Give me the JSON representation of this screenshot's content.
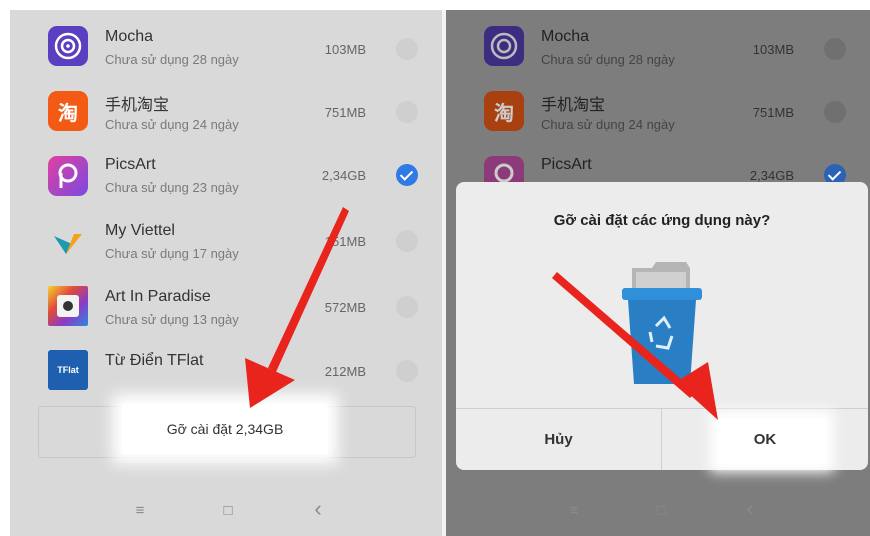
{
  "left_screen": {
    "apps": [
      {
        "name": "Mocha",
        "subtitle": "Chưa sử dụng 28 ngày",
        "size": "103MB",
        "checked": false,
        "icon": "mocha-icon"
      },
      {
        "name": "手机淘宝",
        "subtitle": "Chưa sử dụng 24 ngày",
        "size": "751MB",
        "checked": false,
        "icon": "taobao-icon"
      },
      {
        "name": "PicsArt",
        "subtitle": "Chưa sử dụng 23 ngày",
        "size": "2,34GB",
        "checked": true,
        "icon": "picsart-icon"
      },
      {
        "name": "My Viettel",
        "subtitle": "Chưa sử dụng 17 ngày",
        "size": "151MB",
        "checked": false,
        "icon": "myviettel-icon"
      },
      {
        "name": "Art In Paradise",
        "subtitle": "Chưa sử dụng 13 ngày",
        "size": "572MB",
        "checked": false,
        "icon": "art-in-paradise-icon"
      },
      {
        "name": "Từ Điển TFlat",
        "subtitle": "",
        "size": "212MB",
        "checked": false,
        "icon": "tflat-icon"
      }
    ],
    "uninstall_button": "Gỡ cài đặt 2,34GB",
    "nav": {
      "menu": "≡",
      "home": "□",
      "back": "‹"
    }
  },
  "right_screen": {
    "apps": [
      {
        "name": "Mocha",
        "subtitle": "Chưa sử dụng 28 ngày",
        "size": "103MB",
        "checked": false
      },
      {
        "name": "手机淘宝",
        "subtitle": "Chưa sử dụng 24 ngày",
        "size": "751MB",
        "checked": false
      },
      {
        "name": "PicsArt",
        "subtitle": "",
        "size": "2,34GB",
        "checked": true
      }
    ],
    "dialog": {
      "title": "Gỡ cài đặt các ứng dụng này?",
      "cancel": "Hủy",
      "ok": "OK"
    },
    "nav": {
      "menu": "≡",
      "home": "□",
      "back": "‹"
    }
  },
  "tflat_icon_text": "TFlat",
  "colors": {
    "accent_blue": "#2f7ae5",
    "arrow_red": "#e8241c",
    "trash_blue": "#2e86c8"
  }
}
